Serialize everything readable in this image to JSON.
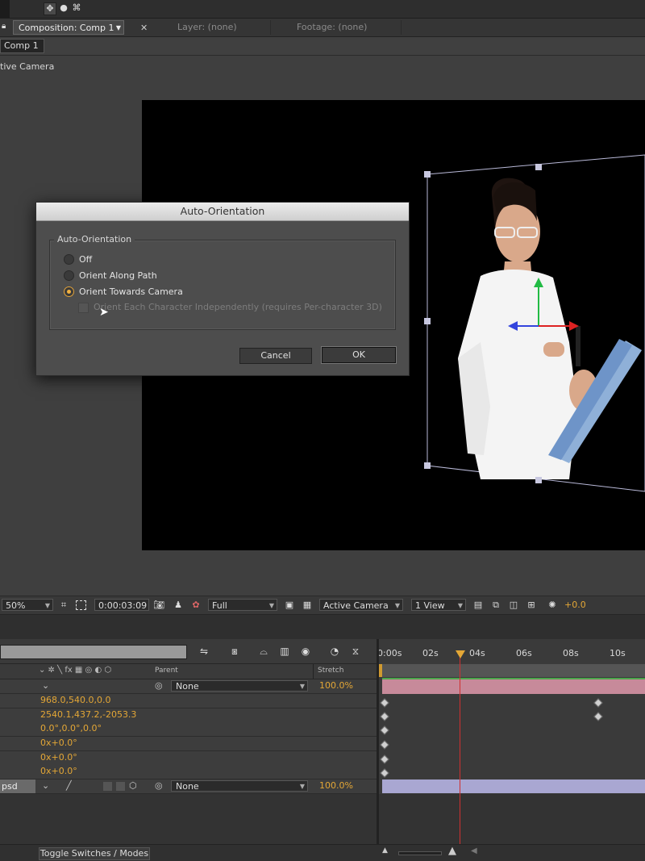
{
  "tabs": {
    "composition": "Composition: Comp 1",
    "layer": "Layer: (none)",
    "footage": "Footage: (none)",
    "comp_name": "Comp 1"
  },
  "viewer": {
    "camera_label": "tive Camera"
  },
  "dialog": {
    "title": "Auto-Orientation",
    "group_label": "Auto-Orientation",
    "options": [
      {
        "label": "Off",
        "selected": false
      },
      {
        "label": "Orient Along Path",
        "selected": false
      },
      {
        "label": "Orient Towards Camera",
        "selected": true
      }
    ],
    "checkbox_label": "Orient Each Character Independently (requires Per-character 3D)",
    "cancel": "Cancel",
    "ok": "OK"
  },
  "viewer_toolbar": {
    "zoom": "50%",
    "timecode": "0:00:03:09",
    "resolution": "Full",
    "view": "Active Camera",
    "layout": "1 View",
    "exposure": "+0.0"
  },
  "timeline": {
    "headers": {
      "parent": "Parent",
      "stretch": "Stretch"
    },
    "rows": [
      {
        "kind": "switches",
        "parent": "None",
        "stretch": "100.0%"
      },
      {
        "kind": "value",
        "value": "968.0,540.0,0.0"
      },
      {
        "kind": "value",
        "value": "2540.1,437.2,-2053.3"
      },
      {
        "kind": "value",
        "value": "0.0°,0.0°,0.0°"
      },
      {
        "kind": "value",
        "value": "0x+0.0°"
      },
      {
        "kind": "value",
        "value": "0x+0.0°"
      },
      {
        "kind": "value",
        "value": "0x+0.0°"
      },
      {
        "kind": "layer",
        "name": "psd",
        "parent": "None",
        "stretch": "100.0%"
      }
    ],
    "ruler": [
      "0:00s",
      "02s",
      "04s",
      "06s",
      "08s",
      "10s"
    ],
    "toggle": "Toggle Switches / Modes"
  },
  "colors": {
    "accent": "#e4a736",
    "playhead": "#d03030",
    "layer_bar_1": "#c78a9a",
    "layer_bar_2": "#a9a7d2"
  }
}
